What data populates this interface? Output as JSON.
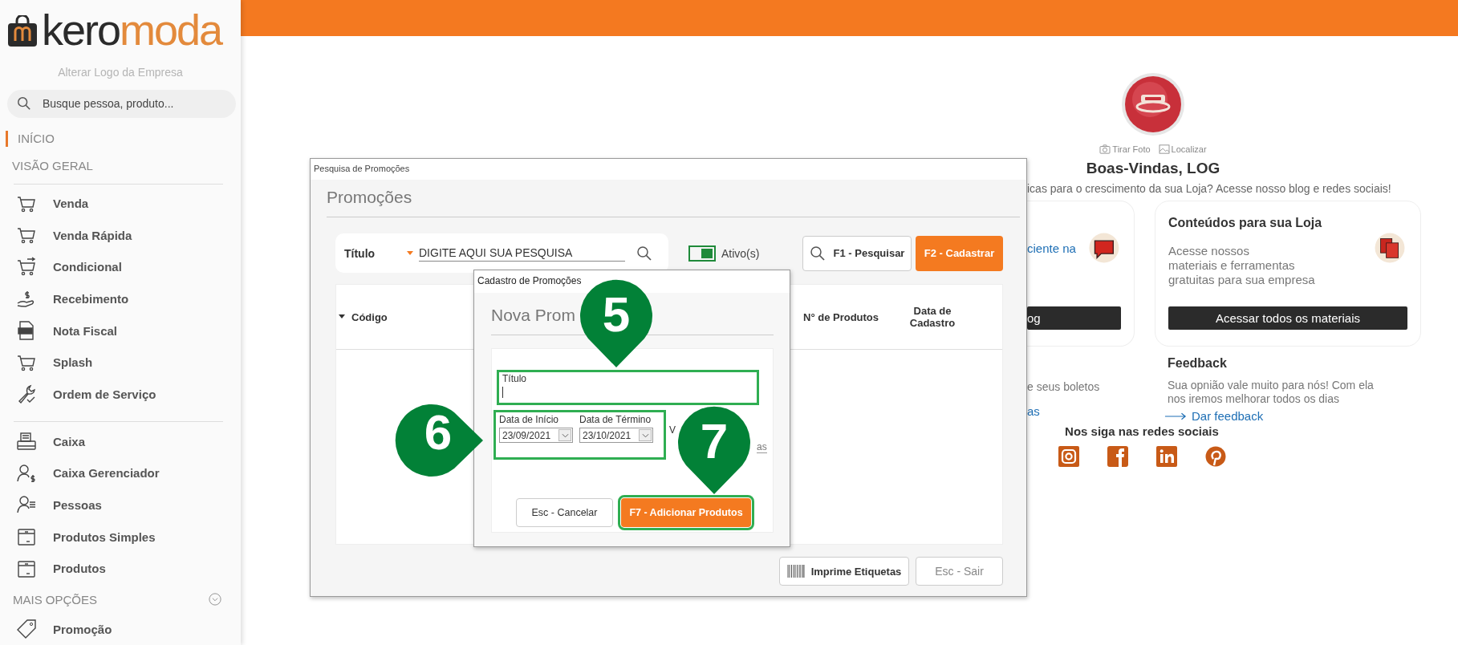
{
  "sidebar": {
    "brand_parts": [
      "kero",
      "moda"
    ],
    "change_logo": "Alterar Logo da Empresa",
    "search": {
      "placeholder": "Busque pessoa, produto..."
    },
    "home": {
      "label": "INÍCIO",
      "selected": true
    },
    "overview": "VISÃO GERAL",
    "groups": [
      {
        "items": [
          "Venda",
          "Venda Rápida",
          "Condicional",
          "Recebimento",
          "Nota Fiscal",
          "Splash",
          "Ordem de Serviço"
        ]
      },
      {
        "items": [
          "Caixa",
          "Caixa Gerenciador",
          "Pessoas",
          "Produtos Simples",
          "Produtos"
        ]
      }
    ],
    "more": {
      "label": "MAIS OPÇÕES",
      "items": [
        "Promoção"
      ]
    }
  },
  "dashboard": {
    "photo_actions": [
      "Tirar Foto",
      "Localizar"
    ],
    "welcome": "Boas-Vindas, LOG",
    "subtitle": "icas para o crescimento da sua Loja? Acesse nosso blog e redes sociais!",
    "cards": [
      {
        "link": "ciente na",
        "button": "og"
      },
      {
        "title": "Conteúdos para sua Loja",
        "text": "Acesse nossos\nmateriais e ferramentas\ngratuitas para sua empresa",
        "button": "Acessar todos os materiais"
      }
    ],
    "boletos": {
      "text": "e seus boletos",
      "link": "as"
    },
    "feedback": {
      "title": "Feedback",
      "text": "Sua opnião vale muito para nós! Com ela\nnos iremos melhorar todos os dias",
      "link": "Dar feedback"
    },
    "social": {
      "title": "Nos siga nas redes sociais"
    }
  },
  "search_window": {
    "title": "Pesquisa de Promoções",
    "heading": "Promoções",
    "filter": {
      "field": "Título",
      "placeholder": "DIGITE AQUI SUA PESQUISA"
    },
    "toggle": {
      "label": "Ativo(s)",
      "on": true
    },
    "buttons": [
      {
        "label": "F1 - Pesquisar",
        "kind": "search"
      },
      {
        "label": "F2 - Cadastrar",
        "kind": "primary"
      }
    ],
    "table": {
      "columns": [
        "Código",
        "N° de Produtos",
        "Data de Cadastro"
      ]
    },
    "footer_buttons": [
      {
        "label": "Imprime Etiquetas",
        "kind": "barcode"
      },
      {
        "label": "Esc - Sair",
        "kind": "plain"
      }
    ]
  },
  "dialog": {
    "title": "Cadastro de Promoções",
    "heading": "Nova Prom",
    "title_field": {
      "label": "Título",
      "highlighted": true
    },
    "dates": {
      "highlighted": true,
      "fields": [
        {
          "label": "Data de Início",
          "value": "23/09/2021"
        },
        {
          "label": "Data de Término",
          "value": "23/10/2021"
        }
      ]
    },
    "partial_label": "V",
    "partial_value": "as",
    "buttons": [
      {
        "label": "Esc - Cancelar",
        "kind": "plain",
        "highlighted": false
      },
      {
        "label": "F7 - Adicionar Produtos",
        "kind": "primary",
        "highlighted": true
      }
    ]
  },
  "markers": [
    {
      "label": "5",
      "kind": "down"
    },
    {
      "label": "6",
      "kind": "right"
    },
    {
      "label": "7",
      "kind": "down"
    }
  ]
}
